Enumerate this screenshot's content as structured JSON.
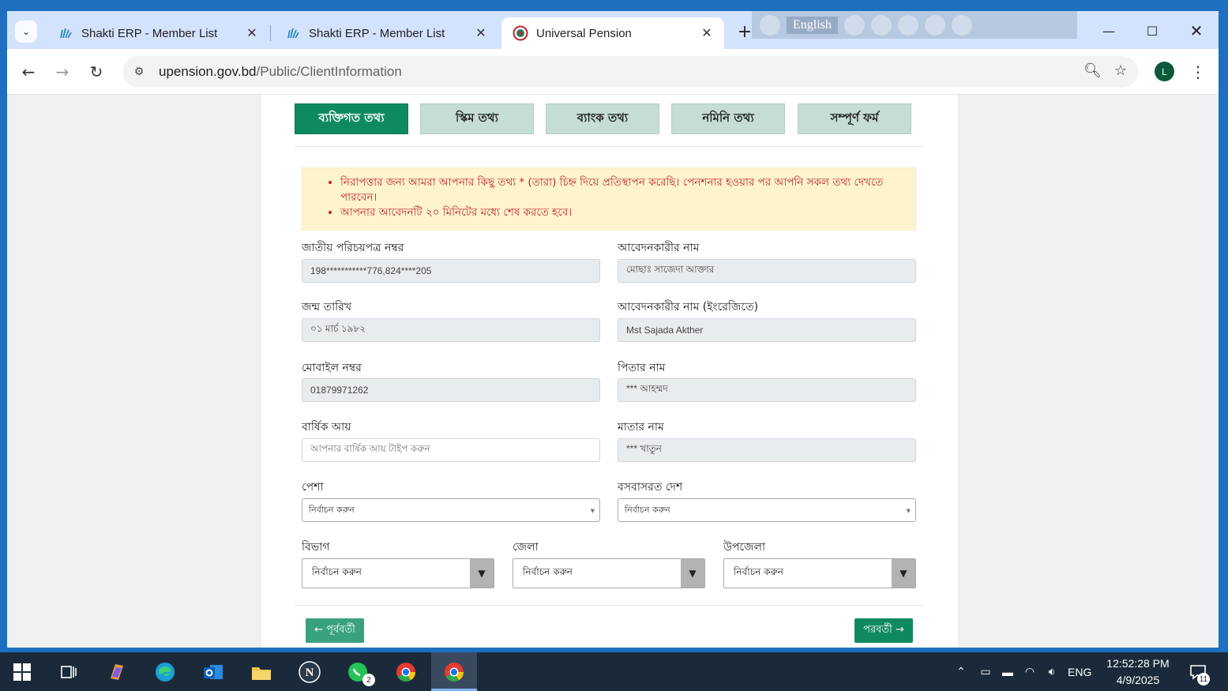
{
  "browser": {
    "tabs": [
      {
        "title": "Shakti ERP - Member List",
        "active": false
      },
      {
        "title": "Shakti ERP - Member List",
        "active": false
      },
      {
        "title": "Universal Pension",
        "active": true
      }
    ],
    "url_host": "upension.gov.bd",
    "url_path": "/Public/ClientInformation",
    "avatar_letter": "L",
    "translate_lang": "English"
  },
  "steps": [
    {
      "label": "ব্যক্তিগত তথ্য",
      "active": true
    },
    {
      "label": "স্কিম তথ্য",
      "active": false
    },
    {
      "label": "ব্যাংক তথ্য",
      "active": false
    },
    {
      "label": "নমিনি তথ্য",
      "active": false
    },
    {
      "label": "সম্পূর্ণ ফর্ম",
      "active": false
    }
  ],
  "alert": {
    "items": [
      "নিরাপত্তার জন্য আমরা আপনার কিছু তথ্য * (তারা) চিহ্ন দিয়ে প্রতিস্থাপন করেছি। পেনশনার হওয়ার পর আপনি সকল তথ্য দেখতে পারবেন।",
      "আপনার আবেদনটি ২০ মিনিটের মধ্যে শেষ করতে হবে।"
    ]
  },
  "form": {
    "nid": {
      "label": "জাতীয় পরিচয়পত্র নম্বর",
      "value": "198***********776,824****205"
    },
    "applicant_name": {
      "label": "আবেদনকারীর নাম",
      "value": "মোছাঃ সাজেদা আক্তার"
    },
    "dob": {
      "label": "জন্ম তারিখ",
      "value": "০১ মার্চ ১৯৮২"
    },
    "applicant_name_en": {
      "label": "আবেদনকারীর নাম (ইংরেজিতে)",
      "value": "Mst Sajada Akther"
    },
    "mobile": {
      "label": "মোবাইল নম্বর",
      "value": "01879971262"
    },
    "father_name": {
      "label": "পিতার নাম",
      "value": "*** আহম্মদ"
    },
    "annual_income": {
      "label": "বার্ষিক আয়",
      "placeholder": "আপনার বার্ষিক আয় টাইপ করুন"
    },
    "mother_name": {
      "label": "মাতার নাম",
      "value": "*** খাতুন"
    },
    "profession": {
      "label": "পেশা",
      "selected": "নির্বাচন করুন"
    },
    "country": {
      "label": "বসবাসরত দেশ",
      "selected": "নির্বাচন করুন"
    },
    "division": {
      "label": "বিভাগ",
      "selected": "নির্বাচন করুন"
    },
    "district": {
      "label": "জেলা",
      "selected": "নির্বাচন করুন"
    },
    "upazila": {
      "label": "উপজেলা",
      "selected": "নির্বাচন করুন"
    }
  },
  "buttons": {
    "prev": "← পূর্ববর্তী",
    "next": "পরবর্তী →"
  },
  "taskbar": {
    "whatsapp_badge": "2",
    "lang": "ENG",
    "time": "12:52:28 PM",
    "date": "4/9/2025",
    "notif_count": "11"
  },
  "colors": {
    "primary": "#0f8a5f",
    "step_inactive": "#c5ddd5",
    "alert_bg": "#fdf3cd",
    "alert_text": "#c0262c"
  }
}
